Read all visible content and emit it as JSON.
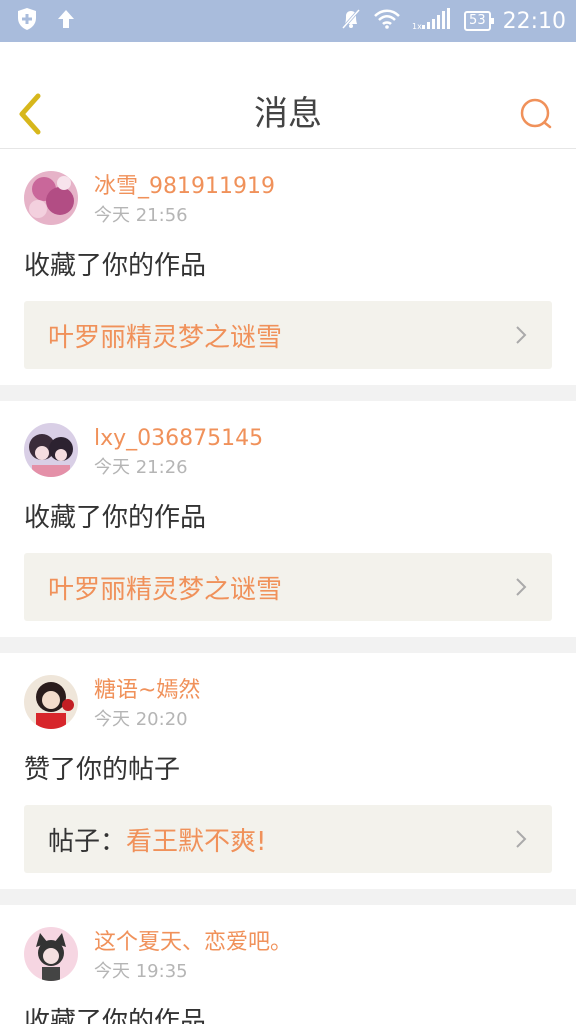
{
  "status_bar": {
    "time": "22:10",
    "battery": "53"
  },
  "nav": {
    "title": "消息"
  },
  "messages": [
    {
      "username": "冰雪_981911919",
      "time": "今天 21:56",
      "action": "收藏了你的作品",
      "target_label": "",
      "target": "叶罗丽精灵梦之谜雪"
    },
    {
      "username": "lxy_036875145",
      "time": "今天 21:26",
      "action": "收藏了你的作品",
      "target_label": "",
      "target": "叶罗丽精灵梦之谜雪"
    },
    {
      "username": "糖语~嫣然",
      "time": "今天 20:20",
      "action": "赞了你的帖子",
      "target_label": "帖子：",
      "target": "看王默不爽!"
    },
    {
      "username": "这个夏天、恋爱吧。",
      "time": "今天 19:35",
      "action": "收藏了你的作品"
    }
  ],
  "colors": {
    "accent": "#f0915a",
    "status_bar": "#a9bcdc",
    "back_arrow": "#d7b71c"
  }
}
